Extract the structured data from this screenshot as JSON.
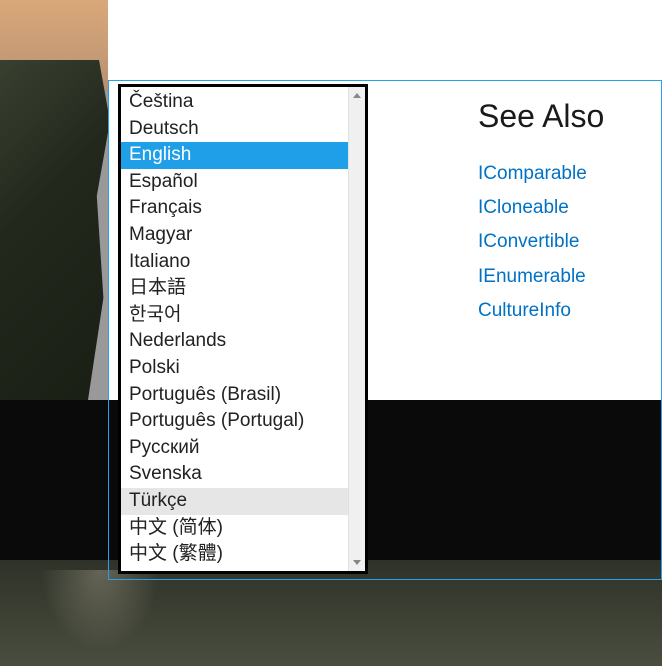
{
  "seeAlso": {
    "heading": "See Also",
    "links": [
      "IComparable",
      "ICloneable",
      "IConvertible",
      "IEnumerable",
      "CultureInfo"
    ]
  },
  "languageDropdown": {
    "selectedIndex": 2,
    "hoverIndex": 15,
    "items": [
      "Čeština",
      "Deutsch",
      "English",
      "Español",
      "Français",
      "Magyar",
      "Italiano",
      "日本語",
      "한국어",
      "Nederlands",
      "Polski",
      "Português (Brasil)",
      "Português (Portugal)",
      "Русский",
      "Svenska",
      "Türkçe",
      "中文 (简体)",
      "中文 (繁體)"
    ]
  }
}
